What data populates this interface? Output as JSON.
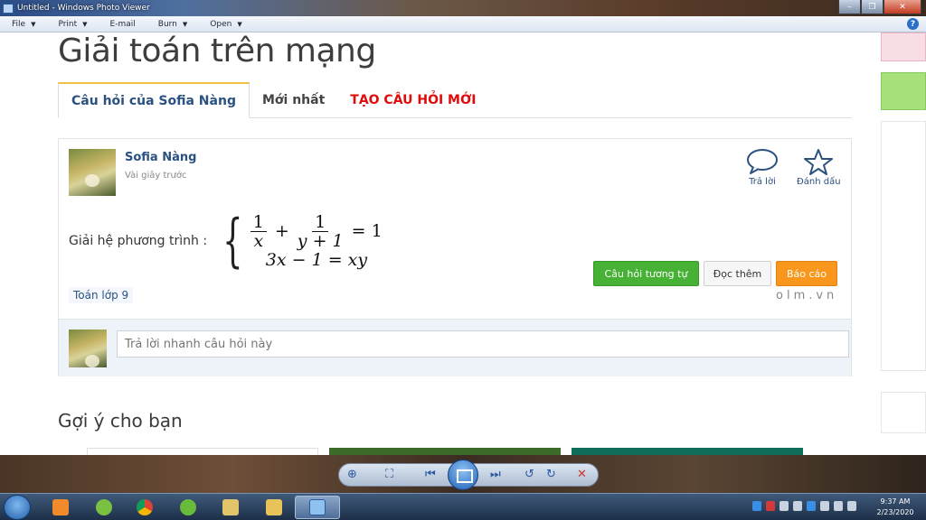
{
  "window": {
    "title": "Untitled - Windows Photo Viewer",
    "min": "–",
    "max": "❐",
    "close": "✕"
  },
  "menubar": {
    "items": [
      {
        "label": "File",
        "caret": "▼"
      },
      {
        "label": "Print",
        "caret": "▼"
      },
      {
        "label": "E-mail",
        "caret": ""
      },
      {
        "label": "Burn",
        "caret": "▼"
      },
      {
        "label": "Open",
        "caret": "▼"
      }
    ],
    "help": "?"
  },
  "page": {
    "title": "Giải toán trên mạng",
    "tabs": [
      {
        "label": "Câu hỏi của Sofia Nàng"
      },
      {
        "label": "Mới nhất"
      },
      {
        "label": "TẠO CÂU HỎI MỚI"
      }
    ]
  },
  "post": {
    "user_name": "Sofia Nàng",
    "time": "Vài giây trước",
    "reply_label": "Trả lời",
    "bookmark_label": "Đánh dấu",
    "question_label": "Giải hệ phương trình :",
    "eq1": {
      "num1": "1",
      "den1": "x",
      "plus": "+",
      "num2": "1",
      "den2": "y + 1",
      "equals": "= 1"
    },
    "eq2": "3x − 1 = xy",
    "tag": "Toán lớp 9",
    "btn_similar": "Câu hỏi tương tự",
    "btn_read": "Đọc thêm",
    "btn_report": "Báo cáo",
    "watermark": "olm.vn",
    "reply_placeholder": "Trả lời nhanh câu hỏi này"
  },
  "suggest": {
    "title": "Gợi ý cho bạn"
  },
  "colors": {
    "link": "#2a5180",
    "red_tab": "#e10b0b",
    "green_btn": "#47b136",
    "orange_btn": "#f8971b"
  },
  "taskbar": {
    "clock_time": "9:37 AM",
    "clock_date": "2/23/2020"
  }
}
